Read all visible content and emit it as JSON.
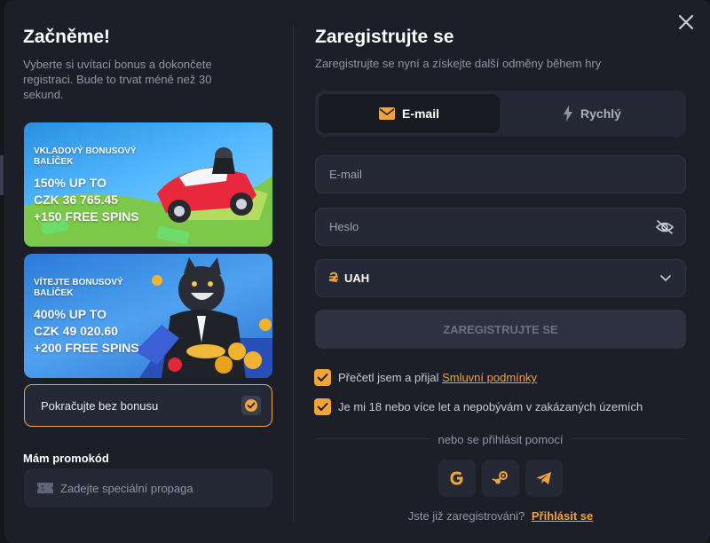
{
  "left": {
    "title": "Začněme!",
    "description": "Vyberte si uvítací bonus a dokončete registraci. Bude to trvat méně než 30 sekund.",
    "bonuses": [
      {
        "label": "VKLADOVÝ BONUSOVÝ BALÍČEK",
        "line1": "150% UP TO",
        "line2": "CZK 36 765.45",
        "line3": "+150 FREE SPINS"
      },
      {
        "label": "VÍTEJTE BONUSOVÝ BALÍČEK",
        "line1": "400% UP TO",
        "line2": "CZK 49 020.60",
        "line3": "+200 FREE SPINS"
      }
    ],
    "no_bonus_label": "Pokračujte bez bonusu",
    "promo_title": "Mám promokód",
    "promo_placeholder": "Zadejte speciální propaga"
  },
  "right": {
    "title": "Zaregistrujte se",
    "subtitle": "Zaregistrujte se nyní a získejte další odměny během hry",
    "tabs": [
      {
        "label": "E-mail",
        "icon": "envelope-icon",
        "active": true
      },
      {
        "label": "Rychlý",
        "icon": "lightning-icon",
        "active": false
      }
    ],
    "email_placeholder": "E-mail",
    "password_placeholder": "Heslo",
    "currency": "UAH",
    "submit_label": "ZAREGISTRUJTE SE",
    "terms_prefix": "Přečetl jsem a přijal",
    "terms_link": "Smluvní podmínky",
    "age_confirm": "Je mi 18 nebo více let a nepobývám v zakázaných územích",
    "or_login": "nebo se přihlásit pomocí",
    "social": [
      "google-icon",
      "steam-icon",
      "telegram-icon"
    ],
    "already_registered": "Jste již zaregistrováni?",
    "login_link": "Přihlásit se"
  },
  "colors": {
    "accent": "#f2a33a",
    "background": "#1c1f27",
    "field": "#252935",
    "muted_text": "#8f96a8"
  }
}
